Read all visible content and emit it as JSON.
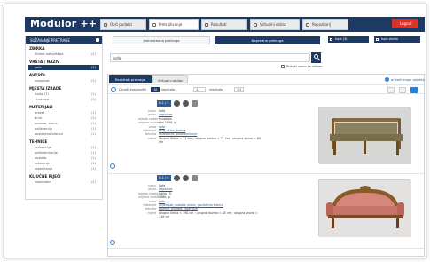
{
  "app": {
    "logo": "Modulor ++"
  },
  "tabs": [
    {
      "label": "Opći podatci"
    },
    {
      "label": "Pretraživanje"
    },
    {
      "label": "Rezultati"
    },
    {
      "label": "Virtualni obilaz"
    },
    {
      "label": "Repozitorij"
    }
  ],
  "logout_label": "Logout",
  "sidebar": {
    "title": "SUŽAVANJE PRETRAGE",
    "sections": [
      {
        "title": "ZBIRKA",
        "items": [
          {
            "label": "Zbirka namještaja",
            "count": "(2)"
          }
        ]
      },
      {
        "title": "VRSTA / NAZIV",
        "items": [
          {
            "label": "sofa",
            "count": "(2)",
            "selected": true
          }
        ]
      },
      {
        "title": "AUTORI",
        "items": [
          {
            "label": "nepoznat",
            "count": "(2)"
          }
        ]
      },
      {
        "title": "MJESTA IZRADE",
        "items": [
          {
            "label": "Italija (?)",
            "count": "(1)"
          },
          {
            "label": "Hrvatska",
            "count": "(1)"
          }
        ]
      },
      {
        "title": "MATERIJALI",
        "items": [
          {
            "label": "brokat",
            "count": "(1)"
          },
          {
            "label": "drvo",
            "count": "(2)"
          },
          {
            "label": "pozlata, bronc.",
            "count": "(1)"
          },
          {
            "label": "polikromija",
            "count": "(1)"
          },
          {
            "label": "pozlaćena bronca",
            "count": "(1)"
          }
        ]
      },
      {
        "title": "TEHNIKE",
        "items": [
          {
            "label": "rezbarenje",
            "count": "(2)"
          },
          {
            "label": "polikromiranje",
            "count": "(1)"
          },
          {
            "label": "pozlata",
            "count": "(1)"
          },
          {
            "label": "tokarenje",
            "count": "(1)"
          },
          {
            "label": "tapeciranje",
            "count": "(1)"
          }
        ]
      },
      {
        "title": "KLJUČNE RIJEČI",
        "items": [
          {
            "label": "klasicizam",
            "count": "(2)"
          }
        ]
      }
    ]
  },
  "search": {
    "simple_label": "Jednostavna pretraga",
    "advanced_label": "Napredna pretraga",
    "query": "sofa",
    "checkbox_label": "Prikaži samo sa slikom"
  },
  "right_buttons": {
    "export": "Ispis (3)",
    "save": "Ispis zbirke"
  },
  "results": {
    "tab_results": "Rezultati pretrage",
    "tab_virtual": "Virtualni obilaz",
    "legend": "prikaži mapu objekta",
    "filter_label": "Označi sve/poništi",
    "per_page_options": [
      "10",
      "20"
    ],
    "per_page_label": "rezultata",
    "page_current": "1",
    "page_of": "1/1",
    "items": [
      {
        "id": "N-1 / 3",
        "fields": [
          {
            "k": "naziv",
            "v": "Sofa"
          },
          {
            "k": "autor",
            "v": "nepoznat",
            "link": true
          },
          {
            "k": "mjesto izrade",
            "v": "Hrvatska"
          },
          {
            "k": "vrijeme izrade",
            "v": "oko 1850. g."
          },
          {
            "k": "vrsta",
            "v": "sofa",
            "link": true
          },
          {
            "k": "materijal",
            "v": "drvo, tkivo, brokat",
            "link": true
          },
          {
            "k": "tehnika",
            "v": "rezbarenje, polikromiranje",
            "link": true
          },
          {
            "k": "mjere",
            "v": "ukupna širina = 71 cm ; ukupna dužina = 71 cm ; ukupna visina = 85"
          },
          {
            "k": "",
            "v": "cm"
          }
        ]
      },
      {
        "id": "N-1 / 6",
        "fields": [
          {
            "k": "naziv",
            "v": "Sofa"
          },
          {
            "k": "autor",
            "v": "nepoznat",
            "link": true
          },
          {
            "k": "mjesto izrade",
            "v": "Italija (?)"
          },
          {
            "k": "vrijeme izrade",
            "v": "1880. g."
          },
          {
            "k": "vrsta",
            "v": "sofa",
            "link": true
          },
          {
            "k": "materijal",
            "v": "svijećnjak, pozlata, bronc, pozlaćena bronca",
            "link": true
          },
          {
            "k": "tehnika",
            "v": "bojenje, pozlata, tokarenje",
            "link": true
          },
          {
            "k": "mjere",
            "v": "ukupna širina = 190 cm ; ukupna dužina = 65 cm ; ukupna visina ="
          },
          {
            "k": "",
            "v": "110 cm"
          }
        ]
      }
    ]
  },
  "colors": {
    "navy": "#1d3a64",
    "accent": "#2b7fd4",
    "danger": "#d9342b"
  }
}
